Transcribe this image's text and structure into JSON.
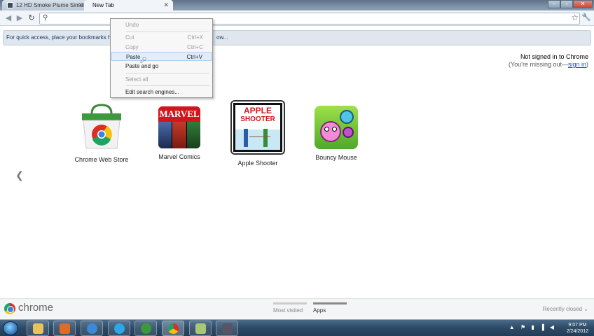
{
  "tabs": [
    {
      "title": "12 HD Smoke Plume Simulat",
      "active": false
    },
    {
      "title": "New Tab",
      "active": true
    }
  ],
  "window_controls": {
    "minimize": "–",
    "maximize": "▫",
    "close": "✕"
  },
  "toolbar": {
    "back": "◀",
    "forward": "▶",
    "reload": "↻",
    "omnibox_value": "",
    "star": "☆",
    "wrench": "🔧"
  },
  "bookmarks_bar": {
    "message": "For quick access, place your bookmarks here",
    "import_link": "ow..."
  },
  "signin": {
    "line1": "Not signed in to Chrome",
    "line2_prefix": "(You're missing out—",
    "link": "sign in",
    "line2_suffix": ")"
  },
  "apps": [
    {
      "label": "Chrome Web Store",
      "icon": "chrome-web-store-icon"
    },
    {
      "label": "Marvel Comics",
      "icon": "marvel-comics-icon",
      "icon_text": "MARVEL"
    },
    {
      "label": "Apple Shooter",
      "icon": "apple-shooter-icon",
      "icon_text_1": "APPLE",
      "icon_text_2": "SHOOTER"
    },
    {
      "label": "Bouncy Mouse",
      "icon": "bouncy-mouse-icon"
    }
  ],
  "prev_page_arrow": "❮",
  "context_menu": {
    "items": [
      {
        "label": "Undo",
        "shortcut": "",
        "enabled": false
      },
      {
        "label": "Cut",
        "shortcut": "Ctrl+X",
        "enabled": false
      },
      {
        "label": "Copy",
        "shortcut": "Ctrl+C",
        "enabled": false
      },
      {
        "label": "Paste",
        "shortcut": "Ctrl+V",
        "enabled": true,
        "hover": true
      },
      {
        "label": "Paste and go",
        "shortcut": "",
        "enabled": true
      },
      {
        "label": "Select all",
        "shortcut": "",
        "enabled": false
      },
      {
        "label": "Edit search engines...",
        "shortcut": "",
        "enabled": true
      }
    ]
  },
  "footer": {
    "brand": "chrome",
    "tab_most_visited": "Most visited",
    "tab_apps": "Apps",
    "recently_closed": "Recently closed ⌄"
  },
  "taskbar": {
    "time": "9:07 PM",
    "date": "2/24/2012",
    "pinned": [
      "explorer-icon",
      "media-player-icon",
      "ie-icon",
      "skype-icon",
      "utorrent-icon",
      "chrome-icon",
      "notepad-icon",
      "app-icon"
    ]
  },
  "colors": {
    "link": "#1155cc",
    "menu_hover": "#e4ecf6"
  }
}
